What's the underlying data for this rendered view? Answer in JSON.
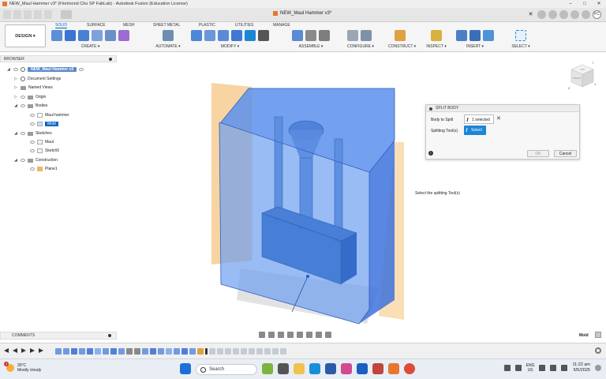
{
  "window": {
    "title": "NEW_Maul Hammer v3* (Florimond Chu SP FabLab) - Autodesk Fusion (Education License)",
    "controls": [
      "–",
      "□",
      "✕"
    ]
  },
  "doc_tab": {
    "title": "NEW_Maul Hammer v3*",
    "close": "✕"
  },
  "user": {
    "initials": "FC"
  },
  "workspace": {
    "label": "DESIGN ▾"
  },
  "workspace_tabs": [
    "SOLID",
    "SURFACE",
    "MESH",
    "SHEET METAL",
    "PLASTIC",
    "UTILITIES",
    "MANAGE"
  ],
  "active_tab": "SOLID",
  "tool_groups": [
    {
      "label": "CREATE ▾"
    },
    {
      "label": "AUTOMATE ▾"
    },
    {
      "label": "MODIFY ▾"
    },
    {
      "label": "ASSEMBLE ▾"
    },
    {
      "label": "CONFIGURE ▾"
    },
    {
      "label": "CONSTRUCT ▾"
    },
    {
      "label": "INSPECT ▾"
    },
    {
      "label": "INSERT ▾"
    },
    {
      "label": "SELECT ▾"
    }
  ],
  "browser": {
    "title": "BROWSER",
    "items": [
      {
        "label": "NEW_Maul Hammer v3"
      },
      {
        "label": "Document Settings"
      },
      {
        "label": "Named Views"
      },
      {
        "label": "Origin"
      },
      {
        "label": "Bodies"
      },
      {
        "label": "Maul hammer"
      },
      {
        "label": "Mold"
      },
      {
        "label": "Sketches"
      },
      {
        "label": "Maul"
      },
      {
        "label": "Sketch5"
      },
      {
        "label": "Construction"
      },
      {
        "label": "Plane1"
      }
    ]
  },
  "split_body": {
    "title": "SPLIT BODY",
    "body_label": "Body to Split",
    "body_value": "1 selected",
    "tool_label": "Splitting Tool(s)",
    "tool_value": "Select",
    "ok": "OK",
    "cancel": "Cancel"
  },
  "hint": "Select the splitting Tool(s)",
  "viewcube": {
    "top": "TOP",
    "front": "FRONT",
    "x": "X",
    "z": "Z"
  },
  "comments": {
    "title": "COMMENTS"
  },
  "mode": {
    "label": "Mold"
  },
  "taskbar": {
    "temperature": "30°C",
    "condition": "Mostly cloudy",
    "notification_count": "4",
    "search_placeholder": "Search",
    "lang_top": "ENG",
    "lang_bottom": "US",
    "time": "11:22 am",
    "date": "5/5/2025"
  },
  "colors": {
    "accent": "#0a66c2",
    "body_blue": "#3d7de8",
    "plane_orange": "#f5c27a"
  }
}
